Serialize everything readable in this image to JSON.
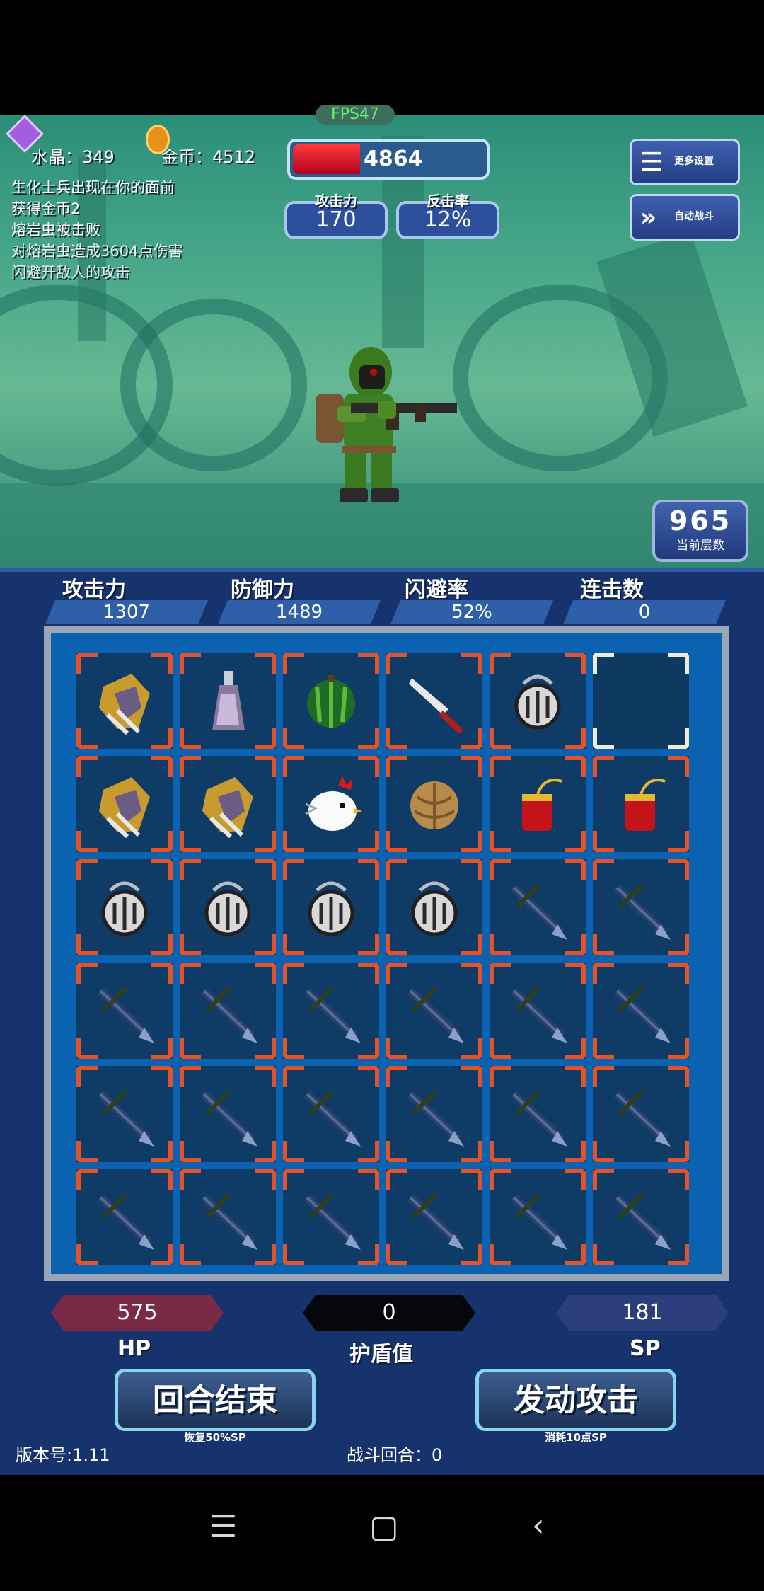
{
  "fps": "FPS47",
  "resources": {
    "crystal": "水晶：349",
    "gold": "金币：4512"
  },
  "battle_log": [
    "生化士兵出现在你的面前",
    "获得金币2",
    "熔岩虫被击败",
    "对熔岩虫造成3604点伤害",
    "闪避开敌人的攻击"
  ],
  "enemy_hp": {
    "value": "4864",
    "fraction": 0.35
  },
  "enemy_stats": [
    {
      "label": "攻击力",
      "value": "170"
    },
    {
      "label": "反击率",
      "value": "12%"
    }
  ],
  "menu_buttons": {
    "settings": "更多设置",
    "auto": "自动战斗"
  },
  "floor": {
    "number": "965",
    "label": "当前层数"
  },
  "player_stats": [
    {
      "label": "攻击力",
      "value": "1307"
    },
    {
      "label": "防御力",
      "value": "1489"
    },
    {
      "label": "闪避率",
      "value": "52%"
    },
    {
      "label": "连击数",
      "value": "0"
    }
  ],
  "grid": [
    [
      "gauntlet-icon",
      "potion-bottle-icon",
      "watermelon-icon",
      "knife-icon",
      "grenade-icon",
      "empty"
    ],
    [
      "gauntlet-icon",
      "gauntlet-icon",
      "chicken-icon",
      "walnut-icon",
      "firecracker-icon",
      "firecracker-icon"
    ],
    [
      "grenade-icon",
      "grenade-icon",
      "grenade-icon",
      "grenade-icon",
      "crossbow-icon",
      "crossbow-icon"
    ],
    [
      "crossbow-icon",
      "crossbow-icon",
      "crossbow-icon",
      "crossbow-icon",
      "crossbow-icon",
      "crossbow-icon"
    ],
    [
      "crossbow-icon",
      "crossbow-icon",
      "crossbow-icon",
      "crossbow-icon",
      "crossbow-icon",
      "crossbow-icon"
    ],
    [
      "crossbow-icon",
      "crossbow-icon",
      "crossbow-icon",
      "crossbow-icon",
      "crossbow-icon",
      "crossbow-icon"
    ]
  ],
  "bottom": {
    "hp": "575",
    "hp_label": "HP",
    "shield": "0",
    "shield_label": "护盾值",
    "sp": "181",
    "sp_label": "SP"
  },
  "actions": {
    "end_turn": "回合结束",
    "end_turn_sub": "恢复50%SP",
    "attack": "发动攻击",
    "attack_sub": "消耗10点SP"
  },
  "footer": {
    "version": "版本号:1.11",
    "round": "战斗回合：0"
  },
  "colors": {
    "hex_hp": "#7a2a44",
    "hex_shield": "#05070d",
    "hex_sp": "#2c3f7c",
    "corner": "#e2532c"
  }
}
